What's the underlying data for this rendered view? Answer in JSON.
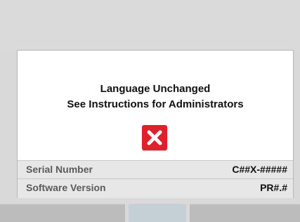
{
  "dialog": {
    "message_line1": "Language Unchanged",
    "message_line2": "See Instructions for Administrators",
    "error_icon": "close-x-icon",
    "error_color": "#e0212b"
  },
  "info": {
    "serial_label": "Serial Number",
    "serial_value": "C##X-#####",
    "software_label": "Software Version",
    "software_value": "PR#.#"
  },
  "softkeys": [
    {
      "label": ""
    },
    {
      "label": ""
    },
    {
      "label": ""
    }
  ]
}
